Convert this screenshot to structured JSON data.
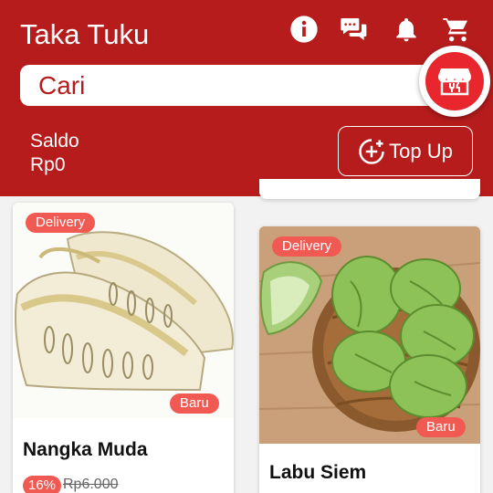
{
  "header": {
    "title": "Taka Tuku",
    "icons": [
      "info-icon",
      "chat-icon",
      "bell-icon",
      "cart-icon",
      "store-icon"
    ],
    "search_placeholder": "Cari",
    "saldo_label": "Saldo",
    "saldo_value": "Rp0",
    "topup_label": "Top Up",
    "colors": {
      "primary": "#b71c1c",
      "badge": "#f05a52",
      "fab": "#e8262d"
    }
  },
  "products": [
    {
      "name": "Nangka Muda",
      "tag_top": "Delivery",
      "tag_bottom": "Baru",
      "discount": "16%",
      "old_price": "Rp6.000"
    },
    {
      "name": "Labu Siem",
      "tag_top": "Delivery",
      "tag_bottom": "Baru"
    }
  ]
}
